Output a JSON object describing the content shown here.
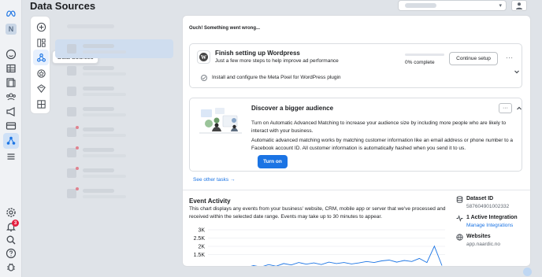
{
  "page": {
    "title": "Data Sources"
  },
  "rail": {
    "logo": "meta-logo-icon",
    "account_initial": "N",
    "notification_count": "3"
  },
  "tools": {
    "tooltip": "Data Sources"
  },
  "error_text": "Ouch! Something went wrong...",
  "setup_card": {
    "title": "Finish setting up Wordpress",
    "subtitle": "Just a few more steps to help improve ad performance",
    "progress_fraction": 0,
    "progress_label": "0% complete",
    "continue_label": "Continue setup",
    "more_label": "···",
    "step_label": "Install and configure the Meta Pixel for WordPress plugin"
  },
  "audience_card": {
    "title": "Discover a bigger audience",
    "p1": "Turn on Automatic Advanced Matching to increase your audience size by including more people who are likely to interact with your business.",
    "p2": "Automatic advanced matching works by matching customer information like an email address or phone number to a Facebook account ID. All customer information is automatically hashed when you send it to us.",
    "button_label": "Turn on",
    "more_label": "···"
  },
  "see_other_tasks": "See other tasks →",
  "event_activity": {
    "title": "Event Activity",
    "description": "This chart displays any events from your business' website, CRM, mobile app or server that we've processed and received within the selected date range. Events may take up to 30 minutes to appear."
  },
  "stats": {
    "dataset_label": "Dataset ID",
    "dataset_value": "587604901002332",
    "integration_label": "1 Active Integration",
    "integration_link": "Manage Integrations",
    "websites_label": "Websites",
    "websites_value": "app.naardic.no"
  },
  "chart_data": {
    "type": "line",
    "yticks": [
      "3K",
      "2.5K",
      "2K",
      "1.5K"
    ],
    "ylim": [
      1000,
      3000
    ],
    "values": [
      1050,
      1100,
      1120,
      1200,
      1150,
      1250,
      1180,
      1300,
      1220,
      1350,
      1280,
      1400,
      1320,
      1380,
      1300,
      1420,
      1350,
      1400,
      1330,
      1380,
      1450,
      1400,
      1480,
      1520,
      1420,
      1500,
      1450,
      1600,
      1400,
      2200,
      1250
    ],
    "line_color": "#1b74e4"
  }
}
